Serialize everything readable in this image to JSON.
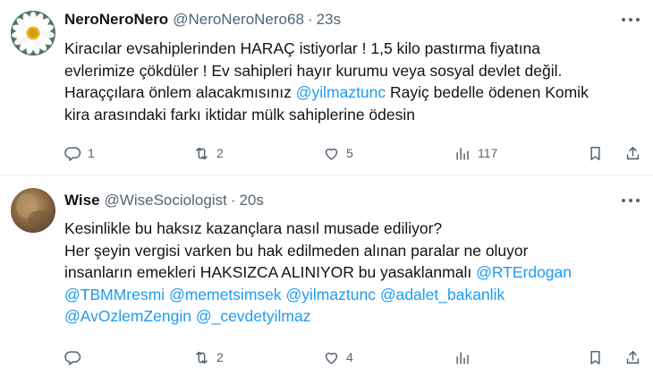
{
  "tweets": [
    {
      "name": "NeroNeroNero",
      "handle": "@NeroNeroNero68",
      "separator": "·",
      "time": "23s",
      "lines": [
        [
          {
            "text": "Kiracılar evsahiplerinden HARAÇ istiyorlar !  1,5 kilo pastırma fiyatına"
          }
        ],
        [
          {
            "text": "evlerimize çökdüler ! Ev sahipleri hayır kurumu veya sosyal devlet değil."
          }
        ],
        [
          {
            "text": "Haraççılara önlem alacakmısınız "
          },
          {
            "text": "@yilmaztunc",
            "mention": true
          },
          {
            "text": "  Rayiç bedelle ödenen Komik"
          }
        ],
        [
          {
            "text": "kira arasındaki farkı iktidar mülk sahiplerine ödesin"
          }
        ]
      ],
      "metrics": {
        "replies": "1",
        "retweets": "2",
        "likes": "5",
        "views": "117"
      },
      "avatar": "daisy-flower"
    },
    {
      "name": "Wise",
      "handle": "@WiseSociologist",
      "separator": "·",
      "time": "20s",
      "lines": [
        [
          {
            "text": "Kesinlikle bu haksız kazançlara nasıl musade ediliyor?"
          }
        ],
        [
          {
            "text": "Her şeyin vergisi varken bu hak edilmeden alınan paralar ne oluyor"
          }
        ],
        [
          {
            "text": "insanların emekleri HAKSIZCA ALINIYOR bu yasaklanmalı "
          },
          {
            "text": "@RTErdogan",
            "mention": true
          }
        ],
        [
          {
            "text": "@TBMMresmi",
            "mention": true
          },
          {
            "text": " "
          },
          {
            "text": "@memetsimsek",
            "mention": true
          },
          {
            "text": " "
          },
          {
            "text": "@yilmaztunc",
            "mention": true
          },
          {
            "text": " "
          },
          {
            "text": "@adalet_bakanlik",
            "mention": true
          }
        ],
        [
          {
            "text": "@AvOzlemZengin",
            "mention": true
          },
          {
            "text": " "
          },
          {
            "text": "@_cevdetyilmaz",
            "mention": true
          }
        ]
      ],
      "metrics": {
        "replies": "",
        "retweets": "2",
        "likes": "4",
        "views": ""
      },
      "avatar": "blurred-photo"
    }
  ],
  "icons": {
    "reply": "reply-icon",
    "retweet": "retweet-icon",
    "like": "heart-icon",
    "views": "views-chart-icon",
    "bookmark": "bookmark-icon",
    "share": "share-icon",
    "more": "more-icon"
  },
  "colors": {
    "text": "#0f1419",
    "secondary": "#536471",
    "mention": "#1d9bf0",
    "divider": "#eff3f4"
  }
}
